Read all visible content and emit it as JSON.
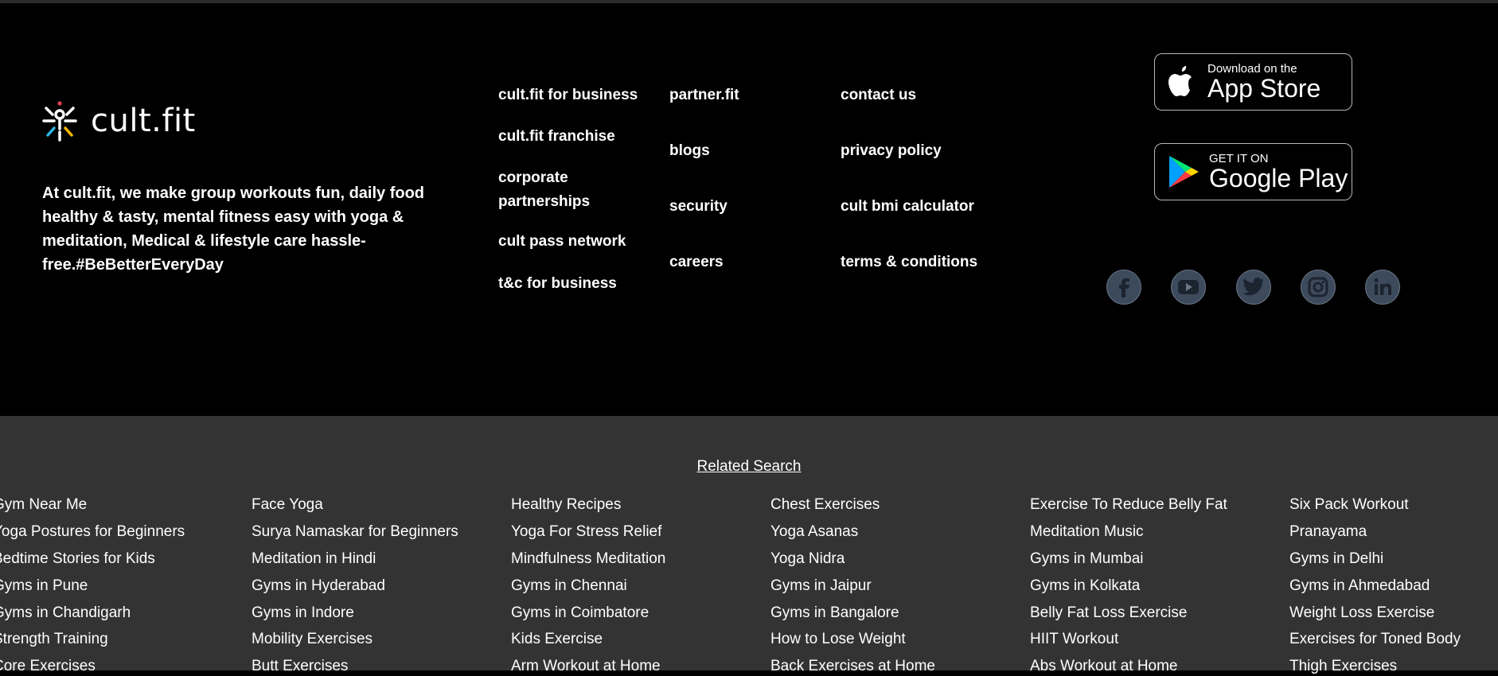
{
  "brand": {
    "name": "cult.fit",
    "tagline": "At cult.fit, we make group workouts fun, daily food healthy & tasty, mental fitness easy with yoga & meditation, Medical & lifestyle care hassle-free.#BeBetterEveryDay"
  },
  "footer_links": {
    "col1": [
      "cult.fit for business",
      "cult.fit franchise",
      "corporate partnerships",
      "cult pass network",
      "t&c for business"
    ],
    "col2": [
      "partner.fit",
      "blogs",
      "security",
      "careers"
    ],
    "col3": [
      "contact us",
      "privacy policy",
      "cult bmi calculator",
      "terms & conditions"
    ]
  },
  "app_store": {
    "small": "Download on the",
    "big": "App Store"
  },
  "google_play": {
    "small": "GET IT ON",
    "big": "Google Play"
  },
  "social_icons": [
    "facebook-icon",
    "youtube-icon",
    "twitter-icon",
    "instagram-icon",
    "linkedin-icon"
  ],
  "related": {
    "title": "Related Search",
    "columns": [
      [
        "Gym Near Me",
        "Yoga Postures for Beginners",
        "Bedtime Stories for Kids",
        "Gyms in Pune",
        "Gyms in Chandigarh",
        "Strength Training",
        "Core Exercises"
      ],
      [
        "Face Yoga",
        "Surya Namaskar for Beginners",
        "Meditation in Hindi",
        "Gyms in Hyderabad",
        "Gyms in Indore",
        "Mobility Exercises",
        "Butt Exercises"
      ],
      [
        "Healthy Recipes",
        "Yoga For Stress Relief",
        "Mindfulness Meditation",
        "Gyms in Chennai",
        "Gyms in Coimbatore",
        "Kids Exercise",
        "Arm Workout at Home"
      ],
      [
        "Chest Exercises",
        "Yoga Asanas",
        "Yoga Nidra",
        "Gyms in Jaipur",
        "Gyms in Bangalore",
        "How to Lose Weight",
        "Back Exercises at Home"
      ],
      [
        "Exercise To Reduce Belly Fat",
        "Meditation Music",
        "Gyms in Mumbai",
        "Gyms in Kolkata",
        "Belly Fat Loss Exercise",
        "HIIT Workout",
        "Abs Workout at Home"
      ],
      [
        "Six Pack Workout",
        "Pranayama",
        "Gyms in Delhi",
        "Gyms in Ahmedabad",
        "Weight Loss Exercise",
        "Exercises for Toned Body",
        "Thigh Exercises"
      ]
    ]
  },
  "colors": {
    "footer_bg": "#000000",
    "related_bg": "#333333",
    "social_bg": "#3c4a5c"
  }
}
